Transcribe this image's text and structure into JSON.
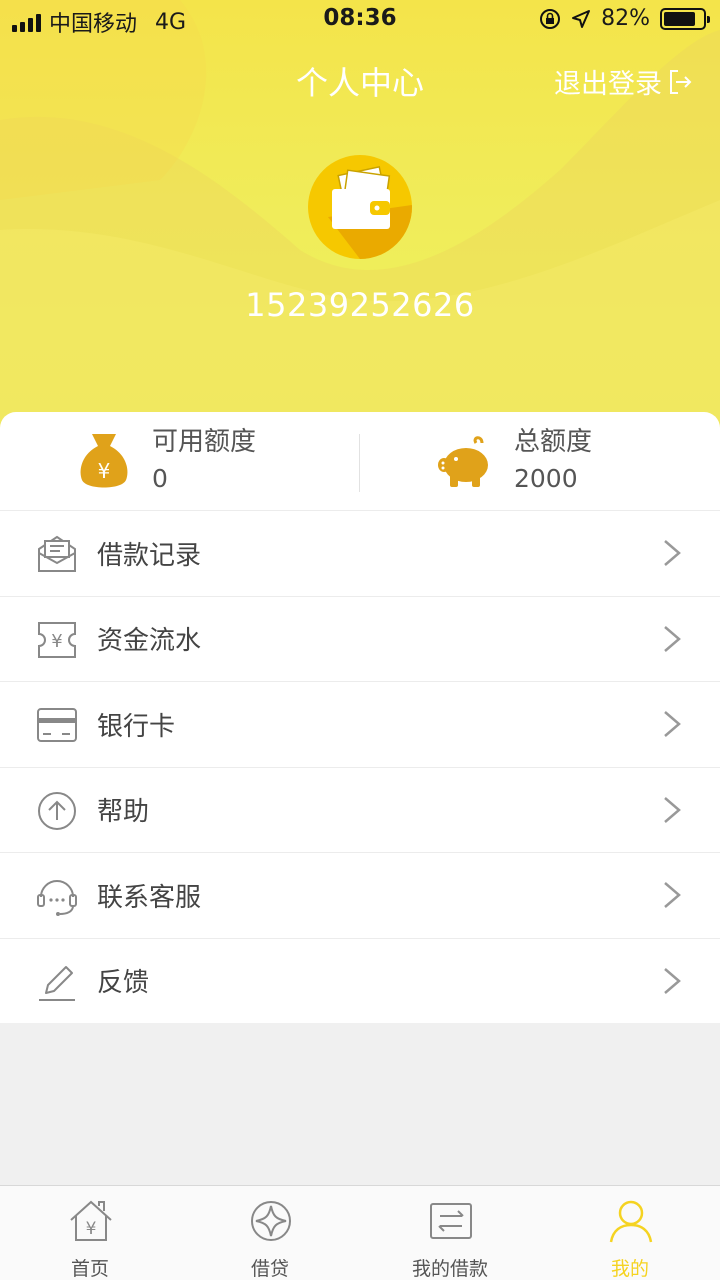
{
  "status_bar": {
    "carrier": "中国移动",
    "network": "4G",
    "time": "08:36",
    "battery": "82%",
    "battery_level": 0.82
  },
  "header": {
    "title": "个人中心",
    "logout_label": "退出登录",
    "avatar_icon": "wallet-icon",
    "phone": "15239252626",
    "colors": {
      "gradient_top": "#f4e44a",
      "gradient_bottom": "#ecf458",
      "accent": "#f5d321"
    }
  },
  "quota": {
    "available": {
      "label": "可用额度",
      "value": "0",
      "icon": "money-bag-icon"
    },
    "total": {
      "label": "总额度",
      "value": "2000",
      "icon": "piggy-bank-icon"
    }
  },
  "menu": [
    {
      "label": "借款记录",
      "icon": "mail-envelope-icon"
    },
    {
      "label": "资金流水",
      "icon": "yuan-ticket-icon"
    },
    {
      "label": "银行卡",
      "icon": "bank-card-icon"
    },
    {
      "label": "帮助",
      "icon": "arrow-up-circle-icon"
    },
    {
      "label": "联系客服",
      "icon": "headset-icon"
    },
    {
      "label": "反馈",
      "icon": "pencil-icon"
    }
  ],
  "tabbar": [
    {
      "label": "首页",
      "icon": "home-yuan-icon",
      "active": false
    },
    {
      "label": "借贷",
      "icon": "loan-star-icon",
      "active": false
    },
    {
      "label": "我的借款",
      "icon": "my-loan-icon",
      "active": false
    },
    {
      "label": "我的",
      "icon": "person-icon",
      "active": true
    }
  ]
}
